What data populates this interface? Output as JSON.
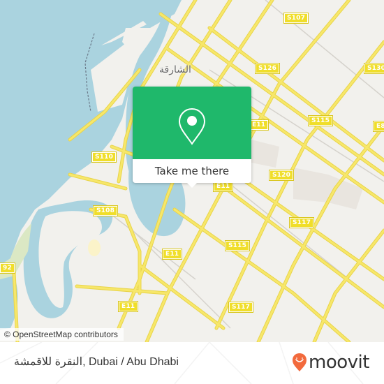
{
  "map": {
    "city_label": "الشارقة",
    "route_shields": [
      {
        "label": "S107"
      },
      {
        "label": "S126"
      },
      {
        "label": "S130"
      },
      {
        "label": "S115"
      },
      {
        "label": "E8"
      },
      {
        "label": "E11"
      },
      {
        "label": "S110"
      },
      {
        "label": "S120"
      },
      {
        "label": "S108"
      },
      {
        "label": "E11"
      },
      {
        "label": "S117"
      },
      {
        "label": "S115"
      },
      {
        "label": "E11"
      },
      {
        "label": "S117"
      },
      {
        "label": "E11"
      },
      {
        "label": "92"
      }
    ],
    "attribution": "© OpenStreetMap contributors",
    "colors": {
      "water": "#aad3df",
      "land": "#f2f1ed",
      "road": "#f7e76a",
      "shield": "#f0de2a"
    }
  },
  "popup": {
    "icon": "map-pin-icon",
    "action_label": "Take me there",
    "color": "#1fb86b"
  },
  "footer": {
    "place_title": "النقرة للاقمشة, Dubai / Abu Dhabi",
    "brand": "moovit",
    "brand_color": "#f26a3d"
  }
}
